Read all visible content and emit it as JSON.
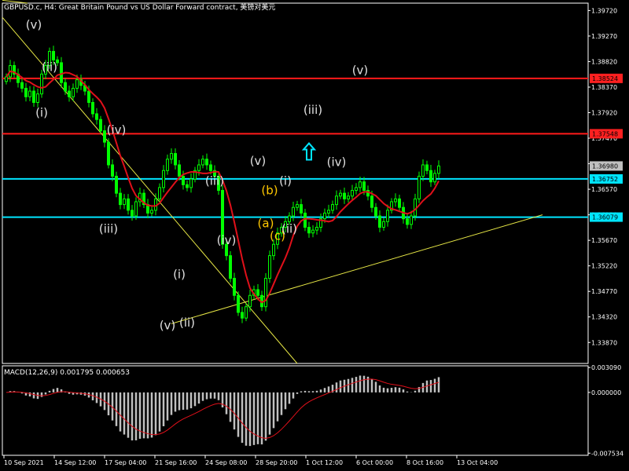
{
  "chart_data": {
    "type": "candlestick",
    "symbol_header": "GBPUSD.c, H4:  Great Britain Pound vs US Dollar Forward contract, 美镑对美元",
    "price_axis": {
      "ticks": [
        "1.39720",
        "1.39270",
        "1.38820",
        "1.38370",
        "1.37920",
        "1.37470",
        "1.37020",
        "1.36570",
        "1.36120",
        "1.35670",
        "1.35220",
        "1.34770",
        "1.34320",
        "1.33870"
      ],
      "ylim": [
        1.335,
        1.3985
      ]
    },
    "time_axis": {
      "labels": [
        "10 Sep 2021",
        "14 Sep 12:00",
        "17 Sep 04:00",
        "21 Sep 16:00",
        "24 Sep 08:00",
        "28 Sep 20:00",
        "1 Oct 12:00",
        "6 Oct 00:00",
        "8 Oct 16:00",
        "13 Oct 04:00"
      ],
      "bar_count": 120
    },
    "price_labels": [
      {
        "text": "1.38524",
        "value": 1.38524,
        "bg": "#ff2020",
        "fg": "#000000"
      },
      {
        "text": "1.37548",
        "value": 1.37548,
        "bg": "#ff2020",
        "fg": "#000000"
      },
      {
        "text": "1.36980",
        "value": 1.3698,
        "bg": "#c0c0c0",
        "fg": "#000000"
      },
      {
        "text": "1.36752",
        "value": 1.36752,
        "bg": "#00e5ff",
        "fg": "#000000"
      },
      {
        "text": "1.36079",
        "value": 1.36079,
        "bg": "#00e5ff",
        "fg": "#000000"
      }
    ],
    "horizontal_lines": [
      {
        "value": 1.38524,
        "color": "#ff1a1a"
      },
      {
        "value": 1.37548,
        "color": "#ff1a1a"
      },
      {
        "value": 1.36752,
        "color": "#00e5ff"
      },
      {
        "value": 1.36079,
        "color": "#00e5ff"
      }
    ],
    "closes": [
      1.3855,
      1.3875,
      1.386,
      1.3845,
      1.3835,
      1.382,
      1.383,
      1.381,
      1.3825,
      1.386,
      1.3875,
      1.39,
      1.3885,
      1.388,
      1.3845,
      1.383,
      1.382,
      1.3835,
      1.385,
      1.384,
      1.383,
      1.381,
      1.379,
      1.378,
      1.376,
      1.374,
      1.37,
      1.368,
      1.365,
      1.363,
      1.364,
      1.362,
      1.361,
      1.3635,
      1.365,
      1.363,
      1.3615,
      1.362,
      1.364,
      1.366,
      1.369,
      1.371,
      1.372,
      1.37,
      1.368,
      1.3665,
      1.366,
      1.3675,
      1.369,
      1.37,
      1.371,
      1.37,
      1.369,
      1.368,
      1.3655,
      1.356,
      1.354,
      1.35,
      1.347,
      1.344,
      1.343,
      1.345,
      1.347,
      1.348,
      1.347,
      1.345,
      1.35,
      1.354,
      1.356,
      1.358,
      1.359,
      1.36,
      1.361,
      1.3625,
      1.363,
      1.3615,
      1.359,
      1.358,
      1.3585,
      1.359,
      1.3605,
      1.3615,
      1.362,
      1.363,
      1.3645,
      1.365,
      1.364,
      1.3645,
      1.3655,
      1.366,
      1.367,
      1.3655,
      1.3645,
      1.3625,
      1.361,
      1.359,
      1.36,
      1.362,
      1.3635,
      1.364,
      1.3625,
      1.3605,
      1.3595,
      1.361,
      1.364,
      1.368,
      1.37,
      1.369,
      1.367,
      1.3685,
      1.3698
    ],
    "moving_average_color": "#e0101a",
    "trendlines": [
      {
        "color": "#e6e645",
        "from": [
          1.3975,
          0
        ],
        "to": [
          1.3336,
          0
        ]
      },
      {
        "color": "#e6e645"
      }
    ],
    "wave_labels": [
      {
        "text": "(v)",
        "color": "#e0e0e0",
        "value": 1.394,
        "bar": 7
      },
      {
        "text": "(ii)",
        "color": "#e0e0e0",
        "value": 1.3865,
        "bar": 11
      },
      {
        "text": "(i)",
        "color": "#e0e0e0",
        "value": 1.3785,
        "bar": 9
      },
      {
        "text": "(iv)",
        "color": "#e0e0e0",
        "value": 1.3755,
        "bar": 28
      },
      {
        "text": "(iii)",
        "color": "#e0e0e0",
        "value": 1.358,
        "bar": 26
      },
      {
        "text": "(v)",
        "color": "#e0e0e0",
        "value": 1.341,
        "bar": 41
      },
      {
        "text": "(i)",
        "color": "#e0e0e0",
        "value": 1.35,
        "bar": 44
      },
      {
        "text": "(ii)",
        "color": "#e0e0e0",
        "value": 1.3415,
        "bar": 46
      },
      {
        "text": "(iii)",
        "color": "#e0e0e0",
        "value": 1.3665,
        "bar": 53
      },
      {
        "text": "(iv)",
        "color": "#e0e0e0",
        "value": 1.356,
        "bar": 56
      },
      {
        "text": "(v)",
        "color": "#e0e0e0",
        "value": 1.37,
        "bar": 64
      },
      {
        "text": "(b)",
        "color": "#ffc800",
        "value": 1.3648,
        "bar": 67
      },
      {
        "text": "(a)",
        "color": "#ffc800",
        "value": 1.359,
        "bar": 66
      },
      {
        "text": "(c)",
        "color": "#ffc800",
        "value": 1.3568,
        "bar": 69
      },
      {
        "text": "(i)",
        "color": "#e0e0e0",
        "value": 1.3665,
        "bar": 71
      },
      {
        "text": "(ii)",
        "color": "#e0e0e0",
        "value": 1.358,
        "bar": 72
      },
      {
        "text": "(iii)",
        "color": "#e0e0e0",
        "value": 1.379,
        "bar": 78
      },
      {
        "text": "(iv)",
        "color": "#e0e0e0",
        "value": 1.3698,
        "bar": 84
      },
      {
        "text": "(v)",
        "color": "#e0e0e0",
        "value": 1.386,
        "bar": 90
      }
    ],
    "arrow": {
      "color": "#00e5ff",
      "value": 1.372,
      "bar": 77
    },
    "macd": {
      "header": "MACD(12,26,9) 0.001795 0.000653",
      "ticks": [
        "0.003090",
        "0.000000",
        "-0.007534"
      ],
      "ylim": [
        -0.0078,
        0.0033
      ],
      "histogram_color": "#c0c0c0",
      "signal_color": "#e0101a"
    }
  }
}
